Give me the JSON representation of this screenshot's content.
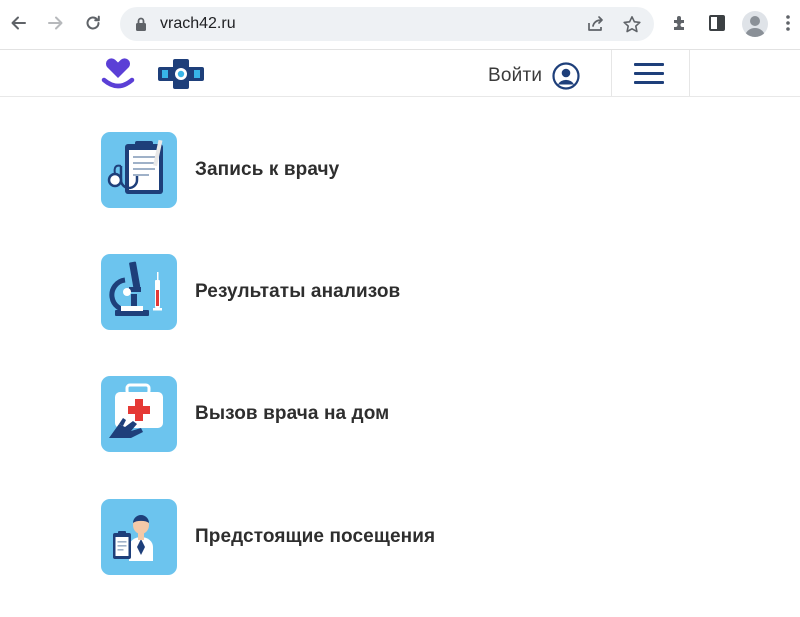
{
  "browser": {
    "url": "vrach42.ru",
    "icons": [
      "back-icon",
      "forward-icon",
      "reload-icon",
      "lock-icon",
      "share-icon",
      "star-icon",
      "extensions-icon",
      "side-panel-icon",
      "profile-icon",
      "kebab-menu-icon"
    ]
  },
  "header": {
    "login_label": "Войти",
    "logo_icons": [
      "gosuslugi-heart-logo",
      "medical-cross-logo"
    ],
    "menu_icon": "hamburger-menu-icon"
  },
  "menu": {
    "items": [
      {
        "label": "Запись к врачу",
        "icon": "clipboard-stethoscope-icon"
      },
      {
        "label": "Результаты анализов",
        "icon": "microscope-syringe-icon"
      },
      {
        "label": "Вызов врача на дом",
        "icon": "first-aid-kit-icon"
      },
      {
        "label": "Предстоящие посещения",
        "icon": "doctor-clipboard-icon"
      }
    ]
  },
  "colors": {
    "tile_bg": "#6cc4ee",
    "brand_blue": "#1e3f7a",
    "logo_purple": "#5b3fd6"
  }
}
